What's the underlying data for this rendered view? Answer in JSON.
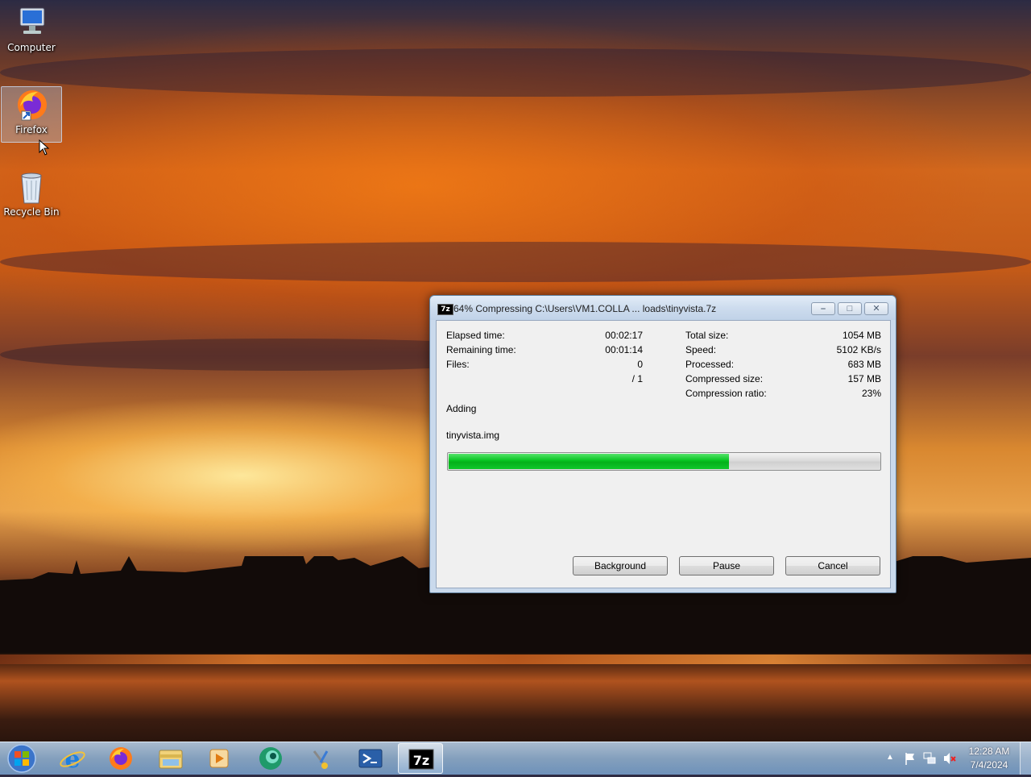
{
  "desktop": {
    "icons": [
      {
        "label": "Computer",
        "icon": "computer-icon"
      },
      {
        "label": "Firefox",
        "icon": "firefox-icon"
      },
      {
        "label": "Recycle Bin",
        "icon": "recycle-bin-icon"
      }
    ]
  },
  "dialog": {
    "title": "64% Compressing C:\\Users\\VM1.COLLA ... loads\\tinyvista.7z",
    "title_icon_text": "7z",
    "left_stats": [
      {
        "label": "Elapsed time:",
        "value": "00:02:17"
      },
      {
        "label": "Remaining time:",
        "value": "00:01:14"
      },
      {
        "label": "Files:",
        "value": "0"
      },
      {
        "label": "",
        "value": "/ 1"
      }
    ],
    "right_stats": [
      {
        "label": "Total size:",
        "value": "1054 MB"
      },
      {
        "label": "Speed:",
        "value": "5102 KB/s"
      },
      {
        "label": "Processed:",
        "value": "683 MB"
      },
      {
        "label": "Compressed size:",
        "value": "157 MB"
      },
      {
        "label": "Compression ratio:",
        "value": "23%"
      }
    ],
    "status": "Adding",
    "current_file": "tinyvista.img",
    "progress_fraction": 0.65,
    "buttons": {
      "background": "Background",
      "pause": "Pause",
      "cancel": "Cancel"
    }
  },
  "taskbar": {
    "items": [
      "internet-explorer-icon",
      "firefox-icon",
      "file-explorer-icon",
      "media-player-icon",
      "app-icon",
      "tools-icon",
      "powershell-icon",
      "7zip-icon"
    ],
    "active_item": "7zip-icon",
    "task_7zip_label": "7z",
    "clock_time": "12:28 AM",
    "clock_date": "7/4/2024"
  },
  "colors": {
    "progress_fill": "#06c320",
    "taskbar": "#9fc0e0"
  }
}
